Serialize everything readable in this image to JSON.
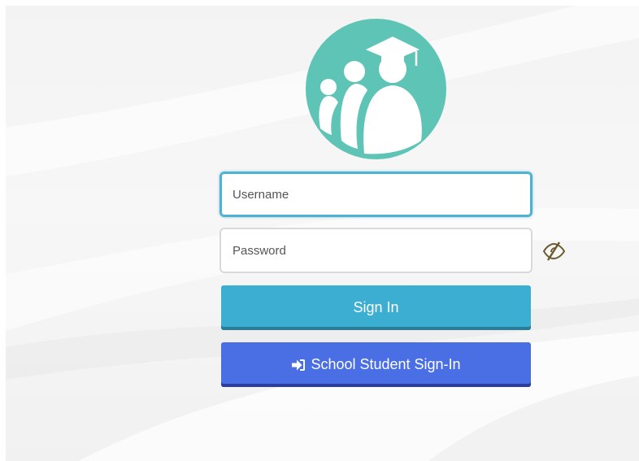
{
  "login_form": {
    "username": {
      "value": "",
      "placeholder": "Username"
    },
    "password": {
      "value": "",
      "placeholder": "Password"
    },
    "toggle_password_icon": "eye-slash-icon",
    "sign_in_label": "Sign In",
    "student_sign_in_label": "School Student Sign-In",
    "student_sign_in_icon": "sign-in-arrow-icon"
  },
  "logo": {
    "icon": "graduation-family-icon"
  },
  "colors": {
    "logo_teal": "#5ec4b6",
    "focus_border": "#4fb0cf",
    "sign_in_button": "#3baed1",
    "student_button": "#4a6ee3",
    "eye_icon": "#6b5a2e"
  }
}
